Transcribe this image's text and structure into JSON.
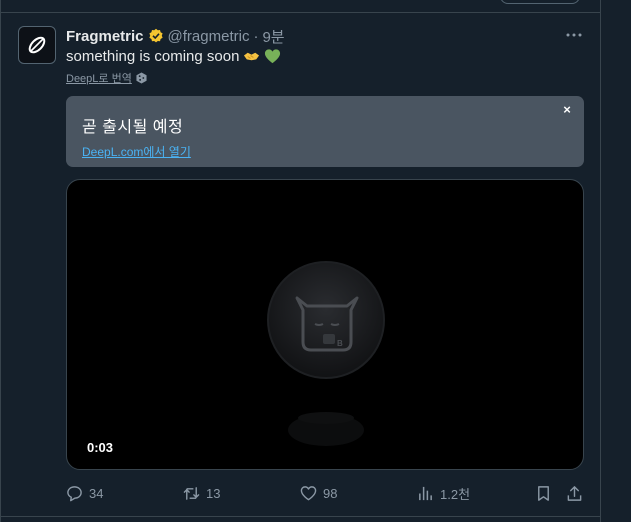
{
  "tweet": {
    "name": "Fragmetric",
    "handle": "@fragmetric",
    "separator": "·",
    "time": "9분",
    "text": "something is coming soon",
    "translate_link": "DeepL로 번역"
  },
  "translation": {
    "text": "곧 출시될 예정",
    "open_link": "DeepL.com에서 열기",
    "close": "×"
  },
  "video": {
    "timestamp": "0:03"
  },
  "actions": {
    "replies": "34",
    "retweets": "13",
    "likes": "98",
    "views": "1.2천"
  },
  "icons": {
    "more": "more-icon",
    "verified": "verified-badge-icon"
  },
  "colors": {
    "background": "#15202b",
    "translation_box": "#4a5561",
    "link": "#4ab3f4",
    "verified": "#f4c430",
    "muted": "#8b98a5"
  }
}
